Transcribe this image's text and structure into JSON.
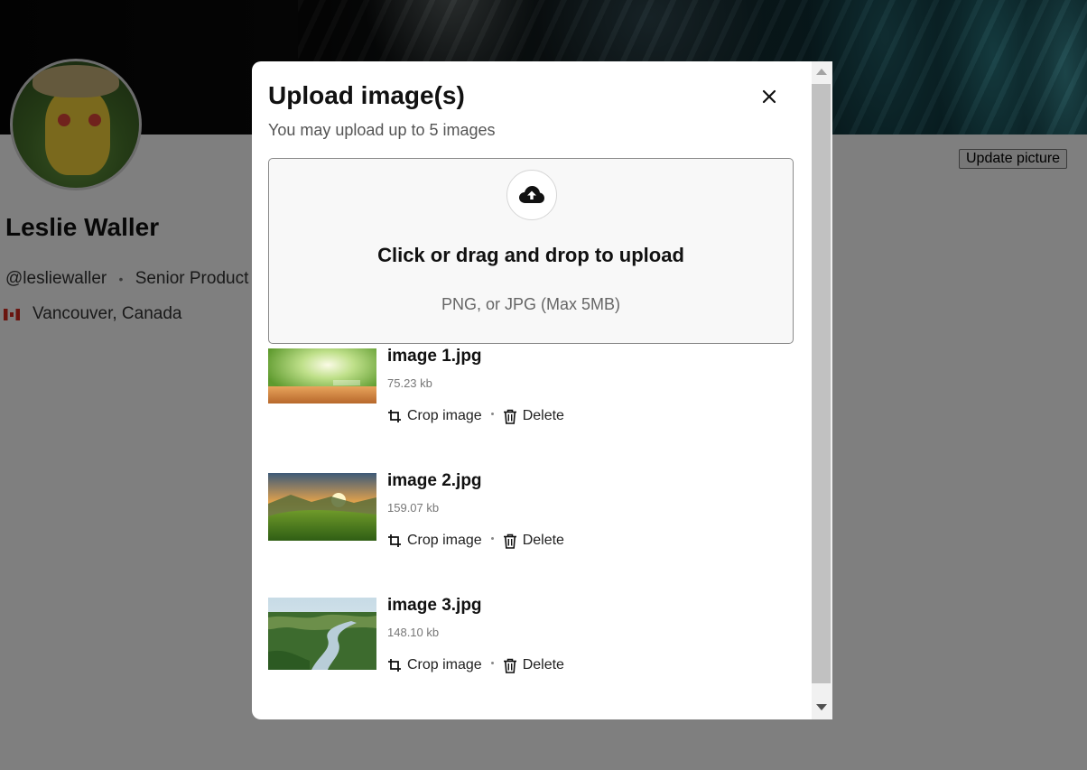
{
  "profile": {
    "update_picture_label": "Update picture",
    "name": "Leslie Waller",
    "handle": "@lesliewaller",
    "title": "Senior Product D",
    "location": "Vancouver, Canada"
  },
  "modal": {
    "title": "Upload image(s)",
    "subtitle": "You may upload up to 5 images",
    "close_icon": "close-icon",
    "dropzone": {
      "icon": "cloud-upload-icon",
      "title": "Click or drag and drop to upload",
      "hint": "PNG, or JPG (Max 5MB)"
    },
    "files": [
      {
        "name": "image 1.jpg",
        "size": "75.23 kb",
        "crop_label": "Crop image",
        "delete_label": "Delete"
      },
      {
        "name": "image 2.jpg",
        "size": "159.07 kb",
        "crop_label": "Crop image",
        "delete_label": "Delete"
      },
      {
        "name": "image 3.jpg",
        "size": "148.10 kb",
        "crop_label": "Crop image",
        "delete_label": "Delete"
      }
    ]
  },
  "colors": {
    "overlay": "#000000",
    "modal_bg": "#ffffff",
    "dropzone_bg": "#f8f8f8",
    "text_primary": "#111111",
    "text_secondary": "#555555"
  }
}
